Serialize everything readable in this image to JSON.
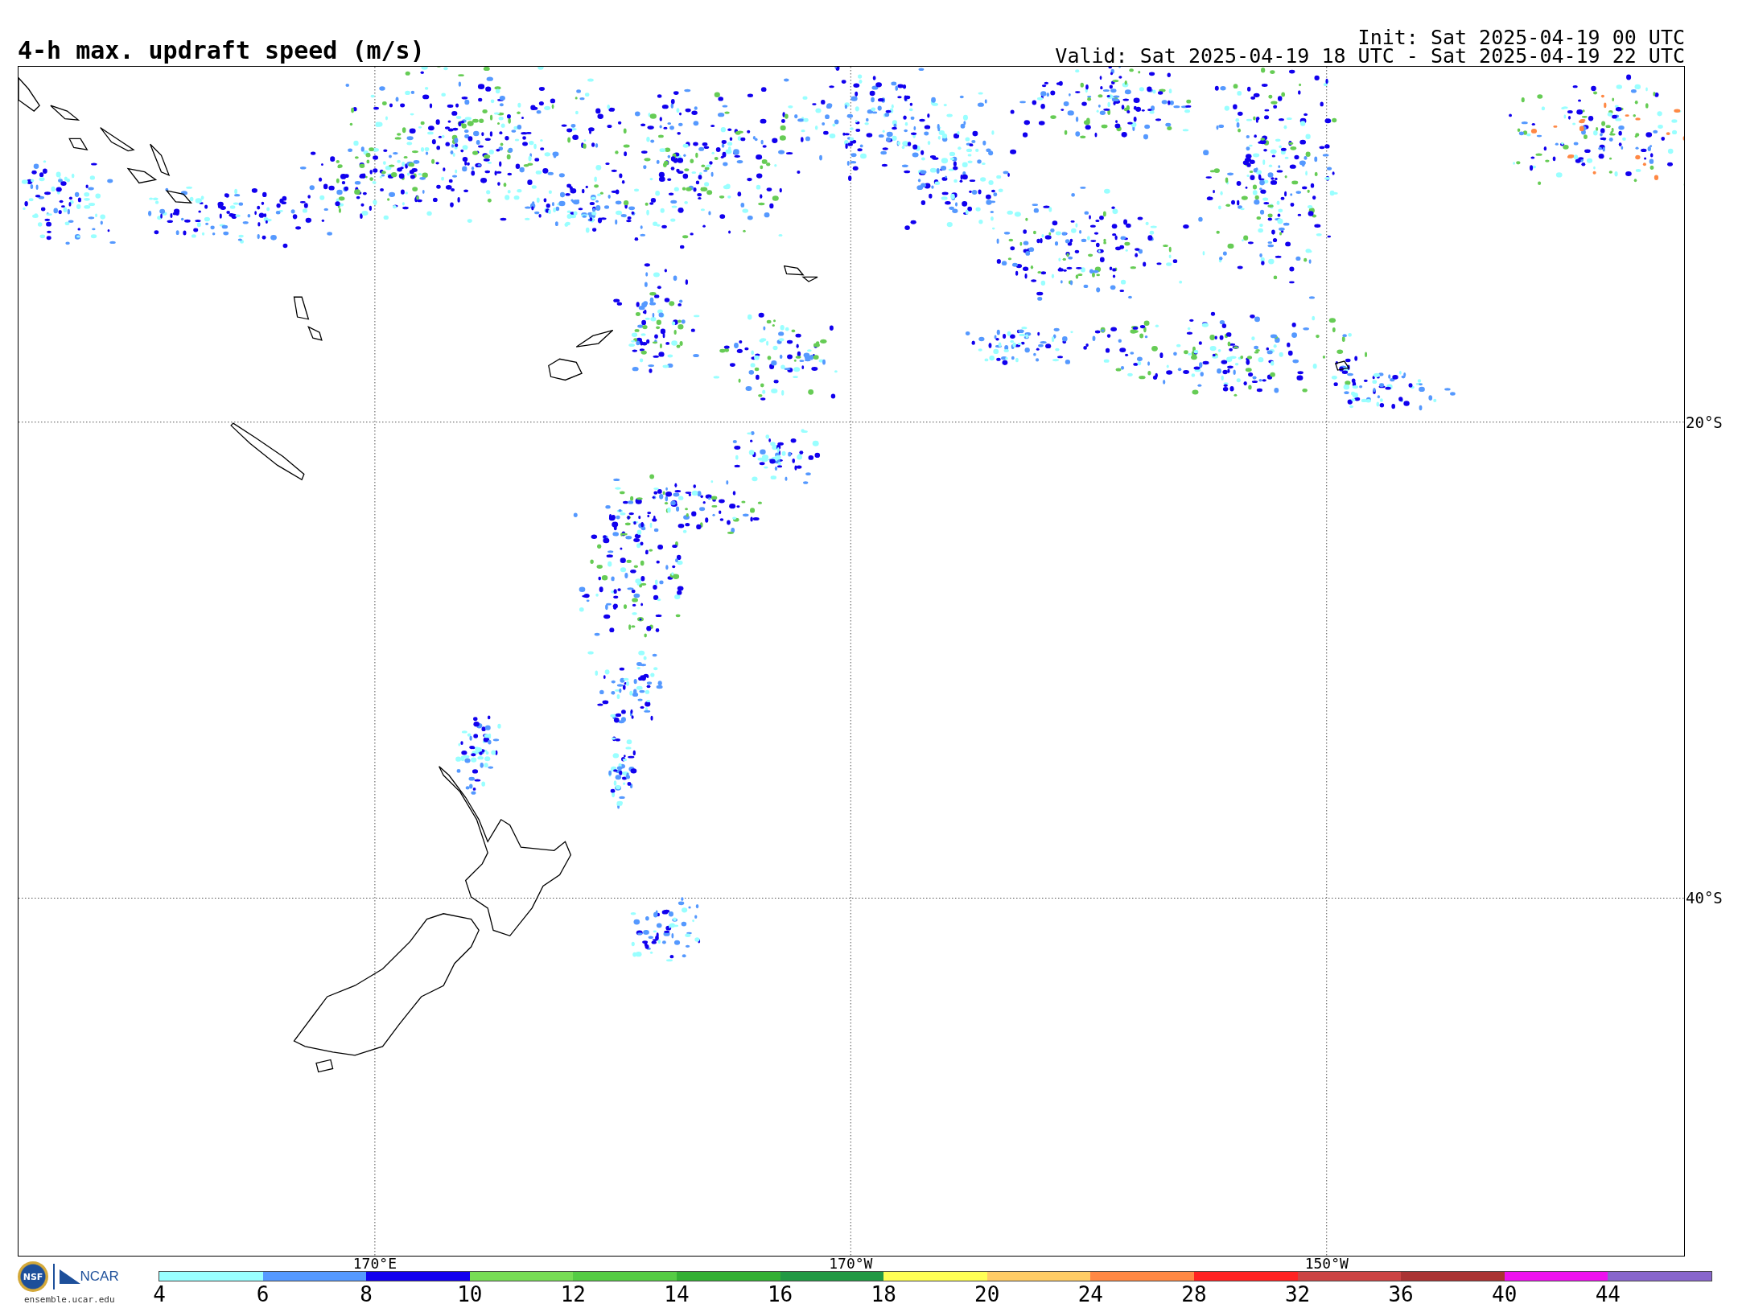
{
  "title": "4-h max. updraft speed (m/s)",
  "init": "Init: Sat 2025-04-19 00 UTC",
  "valid": "Valid: Sat 2025-04-19 18 UTC - Sat 2025-04-19 22 UTC",
  "map": {
    "latitude_labels": [
      "20°S",
      "40°S"
    ],
    "longitude_labels": [
      "170°E",
      "170°W",
      "150°W"
    ]
  },
  "logos": {
    "nsf": "NSF",
    "ncar": "NCAR",
    "url": "ensemble.ucar.edu"
  },
  "colorbar": [
    {
      "label": "4",
      "color": "#99ffff"
    },
    {
      "label": "6",
      "color": "#5599ff"
    },
    {
      "label": "8",
      "color": "#1100ee"
    },
    {
      "label": "10",
      "color": "#77dd55"
    },
    {
      "label": "12",
      "color": "#55cc44"
    },
    {
      "label": "14",
      "color": "#33b033"
    },
    {
      "label": "16",
      "color": "#229944"
    },
    {
      "label": "18",
      "color": "#ffff55"
    },
    {
      "label": "20",
      "color": "#ffcc66"
    },
    {
      "label": "24",
      "color": "#ff8844"
    },
    {
      "label": "28",
      "color": "#ff2222"
    },
    {
      "label": "32",
      "color": "#cc4444"
    },
    {
      "label": "36",
      "color": "#aa3333"
    },
    {
      "label": "40",
      "color": "#ee11ee"
    },
    {
      "label": "44",
      "color": "#8866cc"
    }
  ]
}
